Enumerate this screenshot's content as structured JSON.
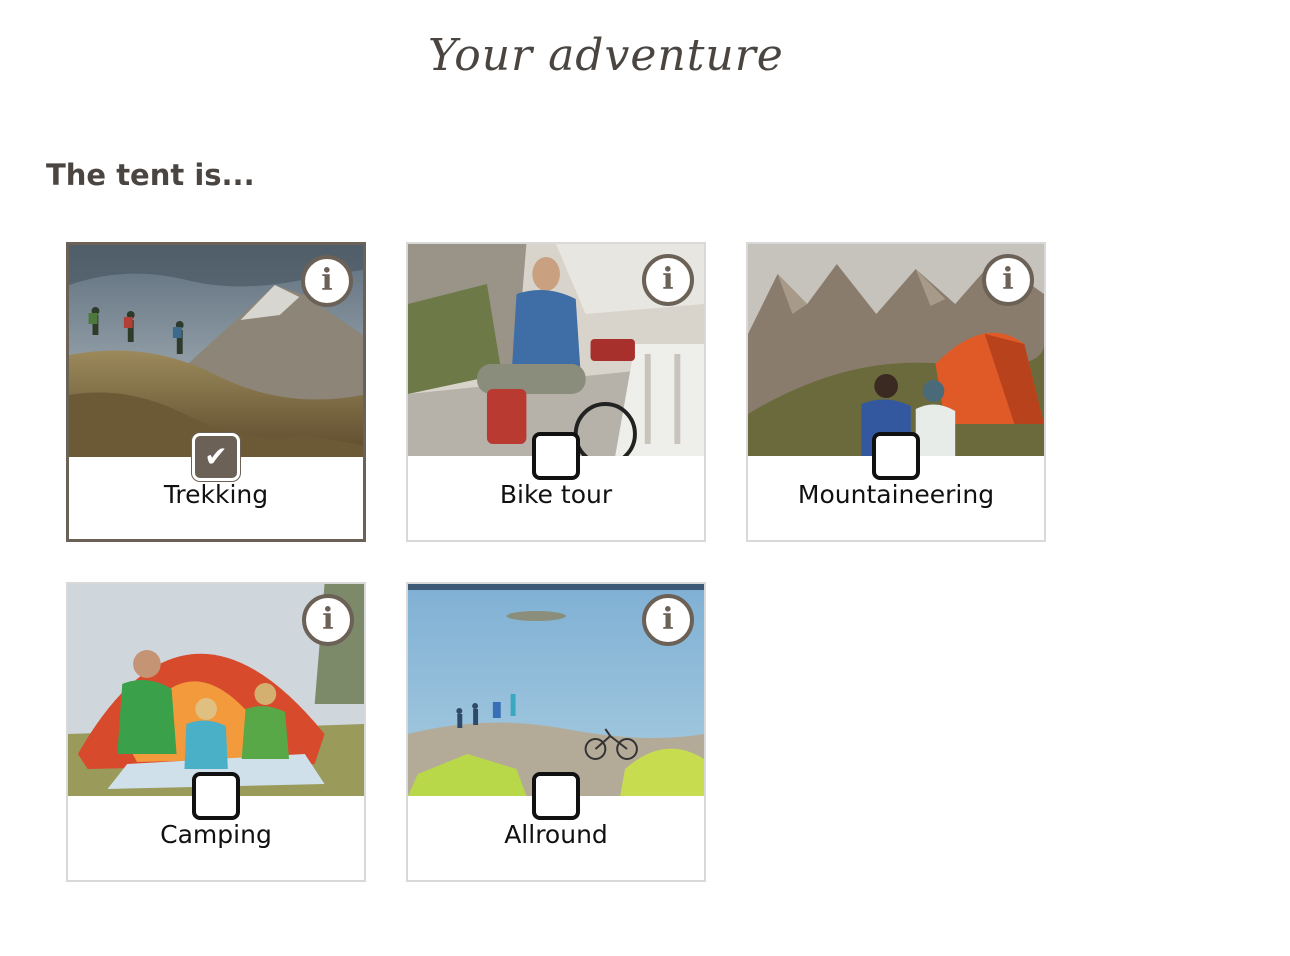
{
  "page": {
    "title": "Your adventure",
    "question": "The tent is..."
  },
  "options": [
    {
      "label": "Trekking",
      "checked": true,
      "image": "hikers-on-mountain-ridge"
    },
    {
      "label": "Bike tour",
      "checked": false,
      "image": "cyclist-with-loaded-bike"
    },
    {
      "label": "Mountaineering",
      "checked": false,
      "image": "climbers-by-orange-tent"
    },
    {
      "label": "Camping",
      "checked": false,
      "image": "family-in-orange-tent"
    },
    {
      "label": "Allround",
      "checked": false,
      "image": "lakeside-camp-with-bikes"
    }
  ],
  "icons": {
    "info": "i",
    "check": "✔"
  },
  "colors": {
    "accent": "#6b6157",
    "text": "#4a4540",
    "border": "#d9d9d9"
  }
}
